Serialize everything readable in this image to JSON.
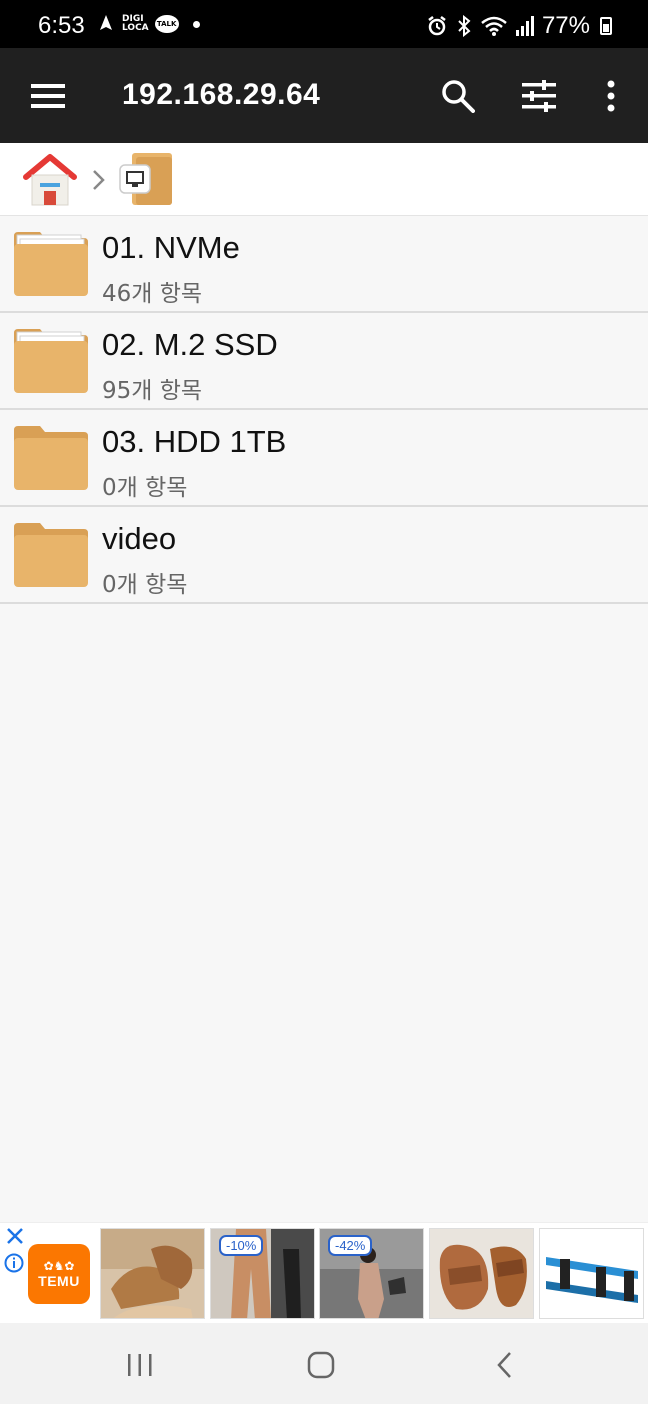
{
  "status_bar": {
    "time": "6:53",
    "digi_top": "DIGI",
    "digi_bottom": "LOCA",
    "talk": "TALK",
    "battery": "77%"
  },
  "toolbar": {
    "title": "192.168.29.64"
  },
  "file_list": {
    "items": [
      {
        "name": "01. NVMe",
        "count": "46개 항목"
      },
      {
        "name": "02. M.2 SSD",
        "count": "95개 항목"
      },
      {
        "name": "03. HDD 1TB",
        "count": "0개 항목"
      },
      {
        "name": "video",
        "count": "0개 항목"
      }
    ]
  },
  "ad": {
    "brand": "TEMU",
    "tags": [
      "-10%",
      "-42%"
    ]
  },
  "colors": {
    "toolbar_bg": "#202020",
    "folder": "#e8b46a",
    "folder_dark": "#d9a055",
    "temu": "#fb7701"
  }
}
